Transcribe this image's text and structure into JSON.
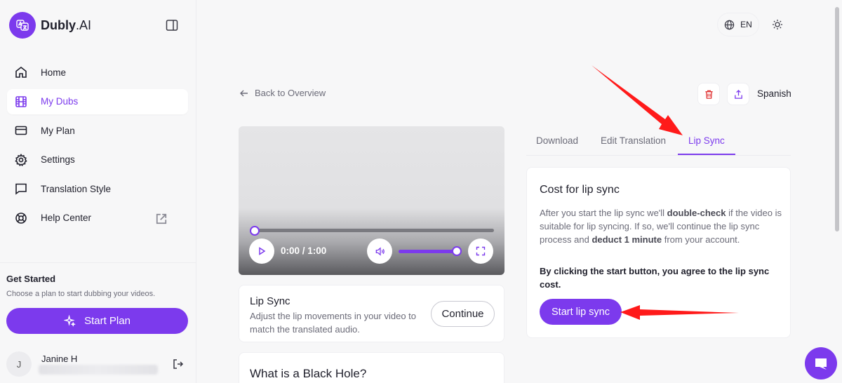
{
  "app": {
    "brand_name": "Dubly",
    "brand_suffix": ".AI",
    "accent_color": "#7c3aed"
  },
  "sidebar": {
    "items": [
      {
        "label": "Home",
        "icon": "home-icon"
      },
      {
        "label": "My Dubs",
        "icon": "film-icon",
        "active": true
      },
      {
        "label": "My Plan",
        "icon": "credit-card-icon"
      },
      {
        "label": "Settings",
        "icon": "gear-icon"
      },
      {
        "label": "Translation Style",
        "icon": "message-square-icon"
      },
      {
        "label": "Help Center",
        "icon": "lifebuoy-icon",
        "external": true
      }
    ],
    "get_started_title": "Get Started",
    "get_started_desc": "Choose a plan to start dubbing your videos.",
    "start_plan_label": "Start Plan",
    "user": {
      "initial": "J",
      "name": "Janine H"
    }
  },
  "topbar": {
    "language": "EN"
  },
  "main": {
    "back_label": "Back to Overview",
    "target_language": "Spanish",
    "video": {
      "time_display": "0:00 / 1:00",
      "progress_fraction": 0.0,
      "volume_fraction": 1.0
    },
    "lipsync_card": {
      "title": "Lip Sync",
      "description": "Adjust the lip movements in your video to match the translated audio.",
      "continue_label": "Continue"
    },
    "video_title": "What is a Black Hole?",
    "tabs": [
      {
        "label": "Download"
      },
      {
        "label": "Edit Translation"
      },
      {
        "label": "Lip Sync",
        "active": true
      }
    ],
    "cost_card": {
      "title": "Cost for lip sync",
      "desc_1": "After you start the lip sync we'll ",
      "desc_bold_1": "double-check",
      "desc_2": " if the video is suitable for lip syncing. If so, we'll continue the lip sync process and ",
      "desc_bold_2": "deduct 1 minute",
      "desc_3": " from your account.",
      "agreement": "By clicking the start button, you agree to the lip sync cost.",
      "start_label": "Start lip sync"
    }
  }
}
